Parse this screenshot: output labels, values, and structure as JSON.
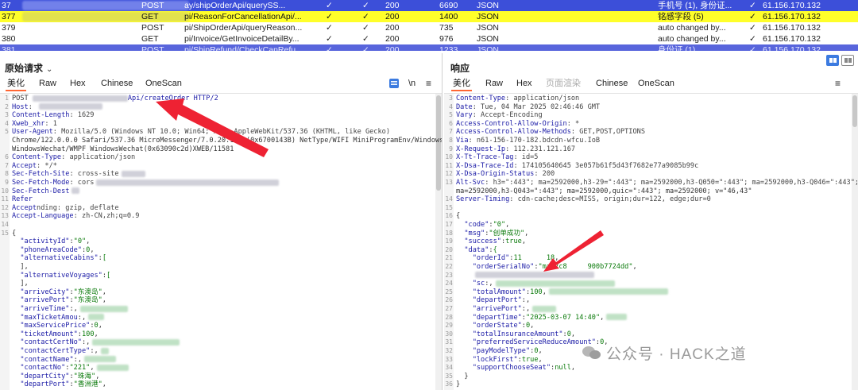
{
  "history": {
    "rows": [
      {
        "id": "37",
        "method": "POST",
        "url": "ay/shipOrderApi/querySS...",
        "check1": "✓",
        "check2": "✓",
        "status": "200",
        "length": "6690",
        "mime": "JSON",
        "comment": "手机号 (1), 身份证...",
        "check3": "✓",
        "ip": "61.156.170.132"
      },
      {
        "id": "377",
        "method": "GET",
        "url": "pi/ReasonForCancellationApi/...",
        "check1": "✓",
        "check2": "✓",
        "status": "200",
        "length": "1400",
        "mime": "JSON",
        "comment": "铭感字段 (5)",
        "check3": "✓",
        "ip": "61.156.170.132"
      },
      {
        "id": "379",
        "method": "POST",
        "url": "pi/ShipOrderApi/queryReason...",
        "check1": "✓",
        "check2": "✓",
        "status": "200",
        "length": "735",
        "mime": "JSON",
        "comment": "auto changed by...",
        "check3": "✓",
        "ip": "61.156.170.132"
      },
      {
        "id": "380",
        "method": "GET",
        "url": "pi/Invoice/GetInvoiceDetailBy...",
        "check1": "✓",
        "check2": "✓",
        "status": "200",
        "length": "976",
        "mime": "JSON",
        "comment": "auto changed by...",
        "check3": "✓",
        "ip": "61.156.170.132"
      },
      {
        "id": "381",
        "method": "POST",
        "url": "pi/ShipRefund/CheckCanRefu...",
        "check1": "✓",
        "check2": "✓",
        "status": "200",
        "length": "1233",
        "mime": "JSON",
        "comment": "身份证 (1)",
        "check3": "✓",
        "ip": "61.156.170.132"
      }
    ]
  },
  "request": {
    "title": "原始请求",
    "tabs": [
      "美化",
      "Raw",
      "Hex",
      "Chinese",
      "OneScan"
    ],
    "tool_newline": "\\n",
    "tool_menu": "≡",
    "lines": [
      {
        "n": "1",
        "t": "POST ",
        "rest": "Api/createOrder HTTP/2"
      },
      {
        "n": "2",
        "k": "Host",
        "v": ": "
      },
      {
        "n": "3",
        "k": "Content-Length",
        "v": ": 1629"
      },
      {
        "n": "4",
        "k": "Xweb_xhr",
        "v": ": 1"
      },
      {
        "n": "5",
        "k": "User-Agent",
        "v": ": Mozilla/5.0 (Windows NT 10.0; Win64; x64) AppleWebKit/537.36 (KHTML, like Gecko)"
      },
      {
        "n": "",
        "t": "Chrome/122.0.0.0 Safari/537.36 MicroMessenger/7.0.20.1781(0x6700143B) NetType/WIFI MiniProgramEnv/Windows"
      },
      {
        "n": "",
        "t": "WindowsWechat/WMPF WindowsWechat(0x63090c2d)XWEB/11581"
      },
      {
        "n": "6",
        "k": "Content-Type",
        "v": ": application/json"
      },
      {
        "n": "7",
        "k": "Accept",
        "v": ": */*"
      },
      {
        "n": "8",
        "k": "Sec-Fetch-Site",
        "v": ": cross-site"
      },
      {
        "n": "9",
        "k": "Sec-Fetch-Mode",
        "v": ": cors"
      },
      {
        "n": "10",
        "k": "Sec-Fetch-Dest",
        "v": ""
      },
      {
        "n": "11",
        "k": "Refer",
        "v": ""
      },
      {
        "n": "12",
        "k": "Accept",
        "v": "nding: gzip, deflate"
      },
      {
        "n": "13",
        "k": "Accept-Language",
        "v": ": zh-CN,zh;q=0.9"
      },
      {
        "n": "14",
        "t": ""
      },
      {
        "n": "15",
        "t": "{"
      },
      {
        "n": "",
        "jk": "\"activityId\"",
        "jv": "\"0\""
      },
      {
        "n": "",
        "jk": "\"phoneAreaCode\"",
        "jv": "0"
      },
      {
        "n": "",
        "jk": "\"alternativeCabins\"",
        "jv": "["
      },
      {
        "n": "",
        "t": "  ],"
      },
      {
        "n": "",
        "jk": "\"alternativeVoyages\"",
        "jv": "["
      },
      {
        "n": "",
        "t": "  ],"
      },
      {
        "n": "",
        "jk": "\"arriveCity\"",
        "jv": "\"东澳岛\""
      },
      {
        "n": "",
        "jk": "\"arrivePort\"",
        "jv": "\"东澳岛\""
      },
      {
        "n": "",
        "jk": "\"arriveTime\"",
        "jv": ""
      },
      {
        "n": "",
        "jk": "\"maxTicketAmou",
        "jv": ""
      },
      {
        "n": "",
        "jk": "\"maxServicePrice\"",
        "jv": "0"
      },
      {
        "n": "",
        "jk": "\"ticketAmount\"",
        "jv": "100"
      },
      {
        "n": "",
        "jk": "\"contactCertNo\"",
        "jv": ""
      },
      {
        "n": "",
        "jk": "\"contactCertType\"",
        "jv": ""
      },
      {
        "n": "",
        "jk": "\"contactName\"",
        "jv": ""
      },
      {
        "n": "",
        "jk": "\"contactNo\"",
        "jv": "\"221\""
      },
      {
        "n": "",
        "jk": "\"departCity\"",
        "jv": "\"珠海\""
      },
      {
        "n": "",
        "jk": "\"departPort\"",
        "jv": "\"香洲港\""
      }
    ]
  },
  "response": {
    "title": "响应",
    "tabs": [
      "美化",
      "Raw",
      "Hex",
      "页面渲染",
      "Chinese",
      "OneScan"
    ],
    "tool_newline": "\\n",
    "tool_menu": "≡",
    "lines": [
      {
        "n": "3",
        "k": "Content-Type",
        "v": ": application/json"
      },
      {
        "n": "4",
        "k": "Date",
        "v": ": Tue, 04 Mar 2025 02:46:46 GMT"
      },
      {
        "n": "5",
        "k": "Vary",
        "v": ": Accept-Encoding"
      },
      {
        "n": "6",
        "k": "Access-Control-Allow-Origin",
        "v": ": *"
      },
      {
        "n": "7",
        "k": "Access-Control-Allow-Methods",
        "v": ": GET,POST,OPTIONS"
      },
      {
        "n": "8",
        "k": "Via",
        "v": ": n61-156-170-182.bdcdn-wfcu.IoB"
      },
      {
        "n": "9",
        "k": "X-Request-Ip",
        "v": ": 112.231.121.167"
      },
      {
        "n": "10",
        "k": "X-Tt-Trace-Tag",
        "v": ": id=5"
      },
      {
        "n": "11",
        "k": "X-Dsa-Trace-Id",
        "v": ": 174105640645 3e057b61f5d43f7682e77a9085b99c"
      },
      {
        "n": "12",
        "k": "X-Dsa-Origin-Status",
        "v": ": 200"
      },
      {
        "n": "13",
        "k": "Alt-Svc",
        "v": ": h3=\":443\"; ma=2592000,h3-29=\":443\"; ma=2592000,h3-Q050=\":443\"; ma=2592000,h3-Q046=\":443\";"
      },
      {
        "n": "",
        "t": "ma=2592000,h3-Q043=\":443\"; ma=2592000,quic=\":443\"; ma=2592000; v=\"46,43\""
      },
      {
        "n": "14",
        "k": "Server-Timing",
        "v": ": cdn-cache;desc=MISS, origin;dur=122, edge;dur=0"
      },
      {
        "n": "15",
        "t": ""
      },
      {
        "n": "16",
        "t": "{"
      },
      {
        "n": "17",
        "jk": "\"code\"",
        "jv": "\"0\""
      },
      {
        "n": "18",
        "jk": "\"msg\"",
        "jv": "\"创单成功\""
      },
      {
        "n": "19",
        "jk": "\"success\"",
        "jv": "true"
      },
      {
        "n": "20",
        "jk": "\"data\"",
        "jv": "{"
      },
      {
        "n": "21",
        "jk": "\"orderId\"",
        "jv": "11      18",
        "ind": 2
      },
      {
        "n": "22",
        "jk": "\"orderSerialNo\"",
        "jv": "\"ma67c8     900b7724dd\"",
        "ind": 2
      },
      {
        "n": "23",
        "jk": "",
        "jv": "",
        "ind": 2
      },
      {
        "n": "24",
        "jk": "\"sc",
        "jv": "",
        "ind": 2
      },
      {
        "n": "25",
        "jk": "\"totalAmount\"",
        "jv": "100",
        "ind": 2
      },
      {
        "n": "26",
        "jk": "\"departPort\"",
        "jv": "",
        "ind": 2
      },
      {
        "n": "27",
        "jk": "\"arrivePort\"",
        "jv": "",
        "ind": 2
      },
      {
        "n": "28",
        "jk": "\"departTime\"",
        "jv": "\"2025-03-07 14:40\"",
        "ind": 2
      },
      {
        "n": "29",
        "jk": "\"orderState\"",
        "jv": "0",
        "ind": 2
      },
      {
        "n": "30",
        "jk": "\"totalInsuranceAmount\"",
        "jv": "0",
        "ind": 2
      },
      {
        "n": "31",
        "jk": "\"preferredServiceReduceAmount\"",
        "jv": "0",
        "ind": 2
      },
      {
        "n": "32",
        "jk": "\"payModelType\"",
        "jv": "0",
        "ind": 2
      },
      {
        "n": "33",
        "jk": "\"lockFirst\"",
        "jv": "true",
        "ind": 2
      },
      {
        "n": "34",
        "jk": "\"supportChooseSeat\"",
        "jv": "null",
        "ind": 2
      },
      {
        "n": "35",
        "t": "  }"
      },
      {
        "n": "36",
        "t": "}"
      }
    ]
  },
  "watermark": {
    "text": "公众号 · HACK之道"
  },
  "colors": {
    "selected_row": "#3c4fd9",
    "highlight_row": "#ffff2a",
    "key": "#1a1aa6",
    "value": "#0a7a0a",
    "tab_underline": "#ff6633",
    "arrow": "#ee2233"
  }
}
